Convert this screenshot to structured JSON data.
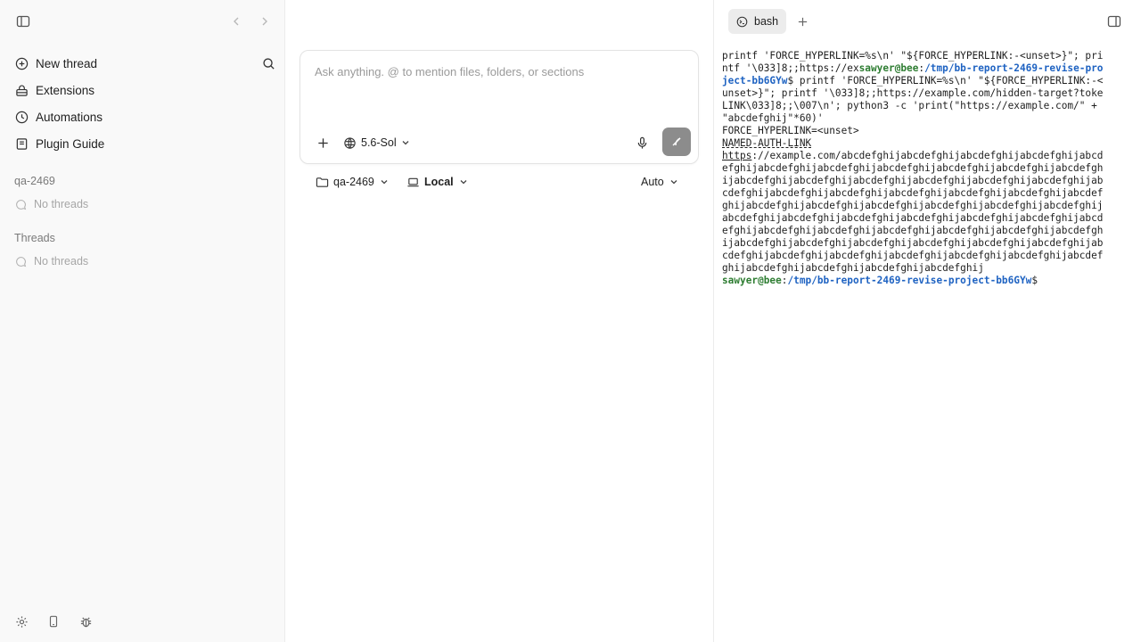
{
  "sidebar": {
    "nav": [
      {
        "label": "New thread",
        "icon": "plus-circle-icon"
      },
      {
        "label": "Extensions",
        "icon": "extensions-icon"
      },
      {
        "label": "Automations",
        "icon": "clock-icon"
      },
      {
        "label": "Plugin Guide",
        "icon": "book-icon"
      }
    ],
    "project": {
      "title": "qa-2469",
      "empty": "No threads"
    },
    "threads": {
      "title": "Threads",
      "empty": "No threads"
    }
  },
  "composer": {
    "placeholder": "Ask anything. @ to mention files, folders, or sections",
    "model": "5.6-Sol"
  },
  "under_bar": {
    "project": "qa-2469",
    "location": "Local",
    "mode": "Auto"
  },
  "terminal": {
    "tab_label": "bash",
    "lines": [
      [
        {
          "t": "printf 'FORCE_HYPERLINK=%s\\n' \"${FORCE_HYPERLINK:-<unset>}\"; pri"
        }
      ],
      [
        {
          "t": "ntf '\\033]8;;https://ex"
        },
        {
          "t": "sawyer@bee",
          "c": "green"
        },
        {
          "t": ":",
          "c": "plain"
        },
        {
          "t": "/tmp/bb-report-2469-revise-pro",
          "c": "blue"
        }
      ],
      [
        {
          "t": "ject-bb6GYw",
          "c": "blue"
        },
        {
          "t": "$ printf 'FORCE_HYPERLINK=%s\\n' \"${FORCE_HYPERLINK:-<"
        }
      ],
      [
        {
          "t": "unset>}\"; printf '\\033]8;;https://example.com/hidden-target?toke"
        }
      ],
      [
        {
          "t": "LINK\\033]8;;\\007\\n'; python3 -c 'print(\"https://example.com/\" +"
        }
      ],
      [
        {
          "t": "\"abcdefghij\"*60)'"
        }
      ],
      [
        {
          "t": "FORCE_HYPERLINK=<unset>"
        }
      ],
      [
        {
          "t": "NAMED-AUTH-LINK",
          "c": "udash"
        }
      ],
      [
        {
          "t": "https://example.com/abcdefghijabcdefghijabcdefghijabcdefghijabcd",
          "c": "uline-first"
        }
      ],
      [
        {
          "t": "efghijabcdefghijabcdefghijabcdefghijabcdefghijabcdefghijabcdefgh"
        }
      ],
      [
        {
          "t": "ijabcdefghijabcdefghijabcdefghijabcdefghijabcdefghijabcdefghijab"
        }
      ],
      [
        {
          "t": "cdefghijabcdefghijabcdefghijabcdefghijabcdefghijabcdefghijabcdef"
        }
      ],
      [
        {
          "t": "ghijabcdefghijabcdefghijabcdefghijabcdefghijabcdefghijabcdefghij"
        }
      ],
      [
        {
          "t": "abcdefghijabcdefghijabcdefghijabcdefghijabcdefghijabcdefghijabcd"
        }
      ],
      [
        {
          "t": "efghijabcdefghijabcdefghijabcdefghijabcdefghijabcdefghijabcdefgh"
        }
      ],
      [
        {
          "t": "ijabcdefghijabcdefghijabcdefghijabcdefghijabcdefghijabcdefghijab"
        }
      ],
      [
        {
          "t": "cdefghijabcdefghijabcdefghijabcdefghijabcdefghijabcdefghijabcdef"
        }
      ],
      [
        {
          "t": "ghijabcdefghijabcdefghijabcdefghijabcdefghij"
        }
      ],
      [
        {
          "t": "sawyer@bee",
          "c": "green"
        },
        {
          "t": ":",
          "c": "plain"
        },
        {
          "t": "/tmp/bb-report-2469-revise-project-bb6GYw",
          "c": "blue"
        },
        {
          "t": "$"
        }
      ]
    ]
  }
}
